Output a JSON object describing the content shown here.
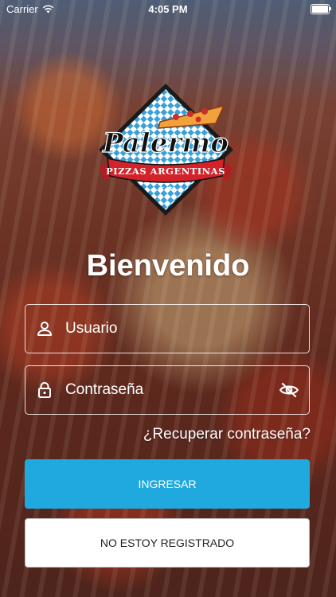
{
  "status_bar": {
    "carrier": "Carrier",
    "time": "4:05 PM"
  },
  "logo": {
    "name": "Palermo",
    "subtitle": "PIZZAS ARGENTINAS"
  },
  "welcome_title": "Bienvenido",
  "username_field": {
    "placeholder": "Usuario",
    "icon": "user-icon"
  },
  "password_field": {
    "placeholder": "Contraseña",
    "icon": "lock-icon",
    "toggle_icon": "eye-off-icon"
  },
  "recover_link": "¿Recuperar contraseña?",
  "login_button": "INGRESAR",
  "register_button": "NO ESTOY REGISTRADO",
  "colors": {
    "primary": "#1fa9df",
    "logo_red": "#d2232a",
    "logo_blue": "#3aa0d8"
  }
}
